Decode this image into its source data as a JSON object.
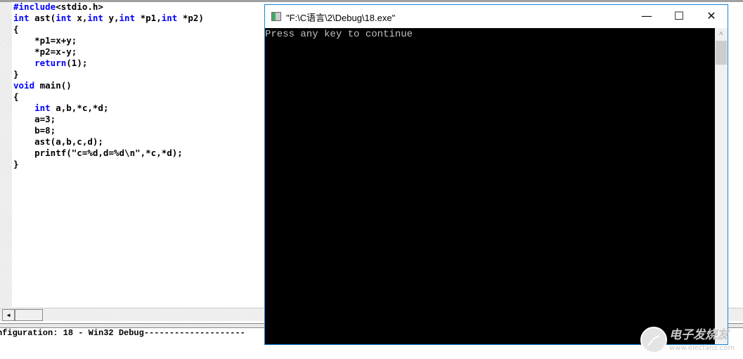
{
  "editor": {
    "lines": [
      [
        {
          "t": "#include",
          "k": true
        },
        {
          "t": "<stdio.h>"
        }
      ],
      [
        {
          "t": "int",
          "k": true
        },
        {
          "t": " ast("
        },
        {
          "t": "int",
          "k": true
        },
        {
          "t": " x,"
        },
        {
          "t": "int",
          "k": true
        },
        {
          "t": " y,"
        },
        {
          "t": "int",
          "k": true
        },
        {
          "t": " *p1,"
        },
        {
          "t": "int",
          "k": true
        },
        {
          "t": " *p2)"
        }
      ],
      [
        {
          "t": "{"
        }
      ],
      [
        {
          "t": "    *p1=x+y;"
        }
      ],
      [
        {
          "t": "    *p2=x-y;"
        }
      ],
      [
        {
          "t": "    "
        },
        {
          "t": "return",
          "k": true
        },
        {
          "t": "(1);"
        }
      ],
      [
        {
          "t": "}"
        }
      ],
      [
        {
          "t": "void",
          "k": true
        },
        {
          "t": " main()"
        }
      ],
      [
        {
          "t": "{"
        }
      ],
      [
        {
          "t": "    "
        },
        {
          "t": "int",
          "k": true
        },
        {
          "t": " a,b,*c,*d;"
        }
      ],
      [
        {
          "t": "    a=3;"
        }
      ],
      [
        {
          "t": "    b=8;"
        }
      ],
      [
        {
          "t": "    ast(a,b,c,d);"
        }
      ],
      [
        {
          "t": "    printf(\"c=%d,d=%d\\n\",*c,*d);"
        }
      ],
      [
        {
          "t": "}"
        }
      ]
    ],
    "keyword_color": "#0000ff"
  },
  "output": {
    "text": "nfiguration: 18 - Win32 Debug--------------------"
  },
  "console": {
    "title": "\"F:\\C语言\\2\\Debug\\18.exe\"",
    "text": "Press any key to continue",
    "minimize": "—",
    "maximize": "☐",
    "close": "✕",
    "up_arrow": "˄",
    "border_color": "#1883d7"
  },
  "watermark": {
    "name": "电子发烧友",
    "url": "www.elecfans.com"
  }
}
